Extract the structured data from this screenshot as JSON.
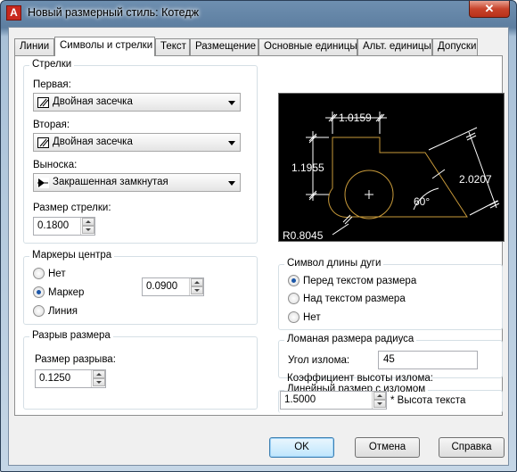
{
  "window": {
    "title": "Новый размерный стиль: Котедж",
    "close_glyph": "✕",
    "app_icon_glyph": "A"
  },
  "tabs": [
    "Линии",
    "Символы и стрелки",
    "Текст",
    "Размещение",
    "Основные единицы",
    "Альт. единицы",
    "Допуски"
  ],
  "arrows": {
    "legend": "Стрелки",
    "first_label": "Первая:",
    "first_value": "Двойная засечка",
    "second_label": "Вторая:",
    "second_value": "Двойная засечка",
    "leader_label": "Выноска:",
    "leader_value": "Закрашенная замкнутая",
    "size_label": "Размер стрелки:",
    "size_value": "0.1800"
  },
  "center_marks": {
    "legend": "Маркеры центра",
    "options": [
      "Нет",
      "Маркер",
      "Линия"
    ],
    "selected": "Маркер",
    "size_value": "0.0900"
  },
  "dim_break": {
    "legend": "Разрыв размера",
    "size_label": "Размер разрыва:",
    "size_value": "0.1250"
  },
  "arc_length": {
    "legend": "Символ длины дуги",
    "options": [
      "Перед текстом размера",
      "Над текстом размера",
      "Нет"
    ],
    "selected": "Перед текстом размера"
  },
  "radius_jog": {
    "legend": "Ломаная размера радиуса",
    "angle_label": "Угол излома:",
    "angle_value": "45"
  },
  "linear_jog": {
    "legend": "Линейный размер с изломом",
    "factor_label": "Коэффициент высоты излома:",
    "factor_value": "1.5000",
    "suffix": "* Высота текста"
  },
  "preview": {
    "dim_top": "1.0159",
    "dim_left": "1.1955",
    "dim_right": "2.0207",
    "angle": "60°",
    "radius": "R0.8045"
  },
  "buttons": {
    "ok": "OK",
    "cancel": "Отмена",
    "help": "Справка"
  },
  "colors": {
    "accent": "#1b56a8",
    "preview_bg": "#000000",
    "geometry": "#c89a3a"
  }
}
